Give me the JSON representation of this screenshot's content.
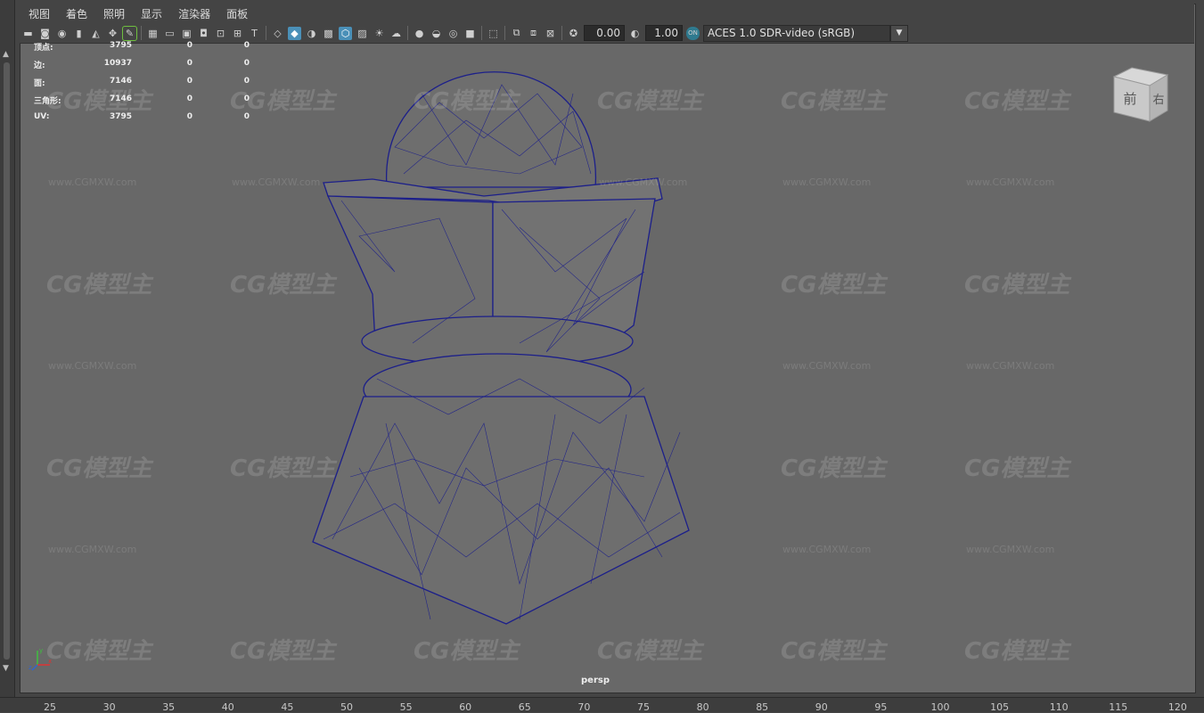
{
  "menubar": {
    "items": [
      "视图",
      "着色",
      "照明",
      "显示",
      "渲染器",
      "面板"
    ]
  },
  "toolbar": {
    "gamma_value": "0.00",
    "exposure_value": "1.00",
    "color_space": "ACES 1.0 SDR-video (sRGB)"
  },
  "hud": {
    "rows": [
      {
        "label": "顶点:",
        "v1": "3795",
        "v2": "0",
        "v3": "0"
      },
      {
        "label": "边:",
        "v1": "10937",
        "v2": "0",
        "v3": "0"
      },
      {
        "label": "面:",
        "v1": "7146",
        "v2": "0",
        "v3": "0"
      },
      {
        "label": "三角形:",
        "v1": "7146",
        "v2": "0",
        "v3": "0"
      },
      {
        "label": "UV:",
        "v1": "3795",
        "v2": "0",
        "v3": "0"
      }
    ]
  },
  "viewcube": {
    "front_label": "前",
    "right_label": "右"
  },
  "camera_label": "persp",
  "watermark": {
    "logo_text": "CG模型主",
    "url_text": "www.CGMXW.com"
  },
  "ruler": {
    "ticks": [
      "25",
      "30",
      "35",
      "40",
      "45",
      "50",
      "55",
      "60",
      "65",
      "70",
      "75",
      "80",
      "85",
      "90",
      "95",
      "100",
      "105",
      "110",
      "115",
      "120"
    ]
  },
  "colors": {
    "wireframe": "#1c1f8a",
    "mesh_fill": "#6e6e6e",
    "viewport_bg": "#686868",
    "accent": "#4a90b8"
  }
}
